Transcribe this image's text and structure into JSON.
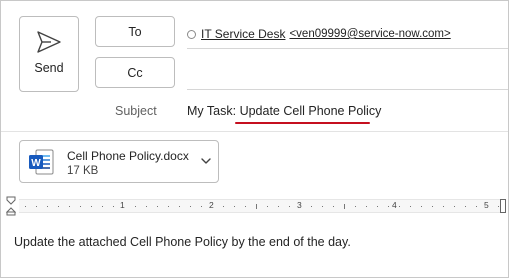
{
  "compose": {
    "send_label": "Send",
    "to_label": "To",
    "cc_label": "Cc",
    "recipient_name": "IT Service Desk",
    "recipient_email": "<ven09999@service-now.com>",
    "subject_label": "Subject",
    "subject_prefix": "My Task:",
    "subject_value": "Update Cell Phone Policy"
  },
  "attachment": {
    "file_name": "Cell Phone Policy.docx",
    "file_size": "17 KB",
    "icon": "word-docx-icon"
  },
  "ruler": {
    "numbers": [
      "1",
      "2",
      "3",
      "4",
      "5"
    ]
  },
  "body": {
    "text": "Update the attached Cell Phone Policy by the end of the day."
  },
  "colors": {
    "spell_underline": "#c50f1f",
    "word_blue": "#185abd"
  }
}
